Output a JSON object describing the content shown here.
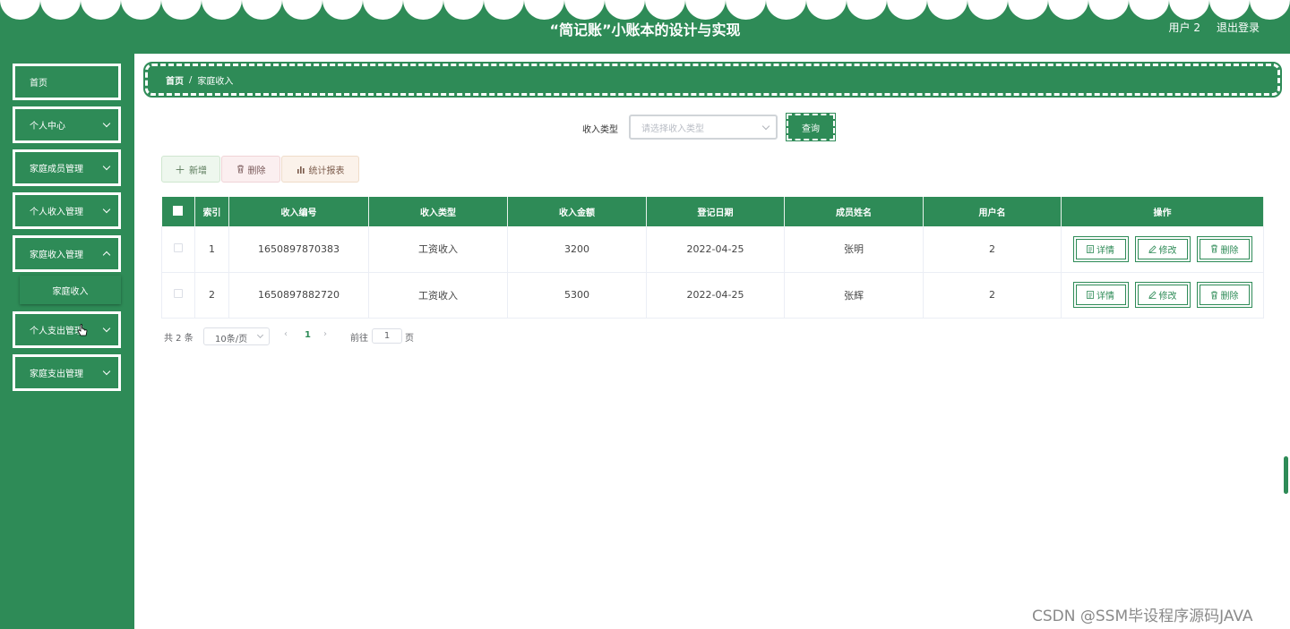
{
  "header": {
    "title": "“简记账”小账本的设计与实现",
    "user": "用户 2",
    "logout": "退出登录"
  },
  "sidebar": {
    "items": [
      {
        "label": "首页",
        "has_children": false
      },
      {
        "label": "个人中心",
        "has_children": true
      },
      {
        "label": "家庭成员管理",
        "has_children": true
      },
      {
        "label": "个人收入管理",
        "has_children": true
      },
      {
        "label": "家庭收入管理",
        "has_children": true
      },
      {
        "label": "个人支出管理",
        "has_children": true
      },
      {
        "label": "家庭支出管理",
        "has_children": true
      }
    ],
    "submenu": {
      "label": "家庭收入"
    }
  },
  "breadcrumb": {
    "home": "首页",
    "separator": "/",
    "current": "家庭收入"
  },
  "search": {
    "label": "收入类型",
    "placeholder": "请选择收入类型",
    "button": "查询"
  },
  "actions": {
    "add": "新增",
    "delete": "删除",
    "stats": "统计报表"
  },
  "table": {
    "headers": [
      "索引",
      "收入编号",
      "收入类型",
      "收入金额",
      "登记日期",
      "成员姓名",
      "用户名",
      "操作"
    ],
    "rows": [
      {
        "index": "1",
        "code": "1650897870383",
        "type": "工资收入",
        "amount": "3200",
        "date": "2022-04-25",
        "member": "张明",
        "username": "2"
      },
      {
        "index": "2",
        "code": "1650897882720",
        "type": "工资收入",
        "amount": "5300",
        "date": "2022-04-25",
        "member": "张辉",
        "username": "2"
      }
    ],
    "ops": {
      "detail": "详情",
      "edit": "修改",
      "delete": "删除"
    }
  },
  "pagination": {
    "total": "共 2 条",
    "page_size": "10条/页",
    "current_page": "1",
    "goto_label": "前往",
    "goto_value": "1",
    "page_suffix": "页"
  },
  "watermark": "CSDN @SSM毕设程序源码JAVA",
  "colors": {
    "primary": "#2e8b57"
  }
}
